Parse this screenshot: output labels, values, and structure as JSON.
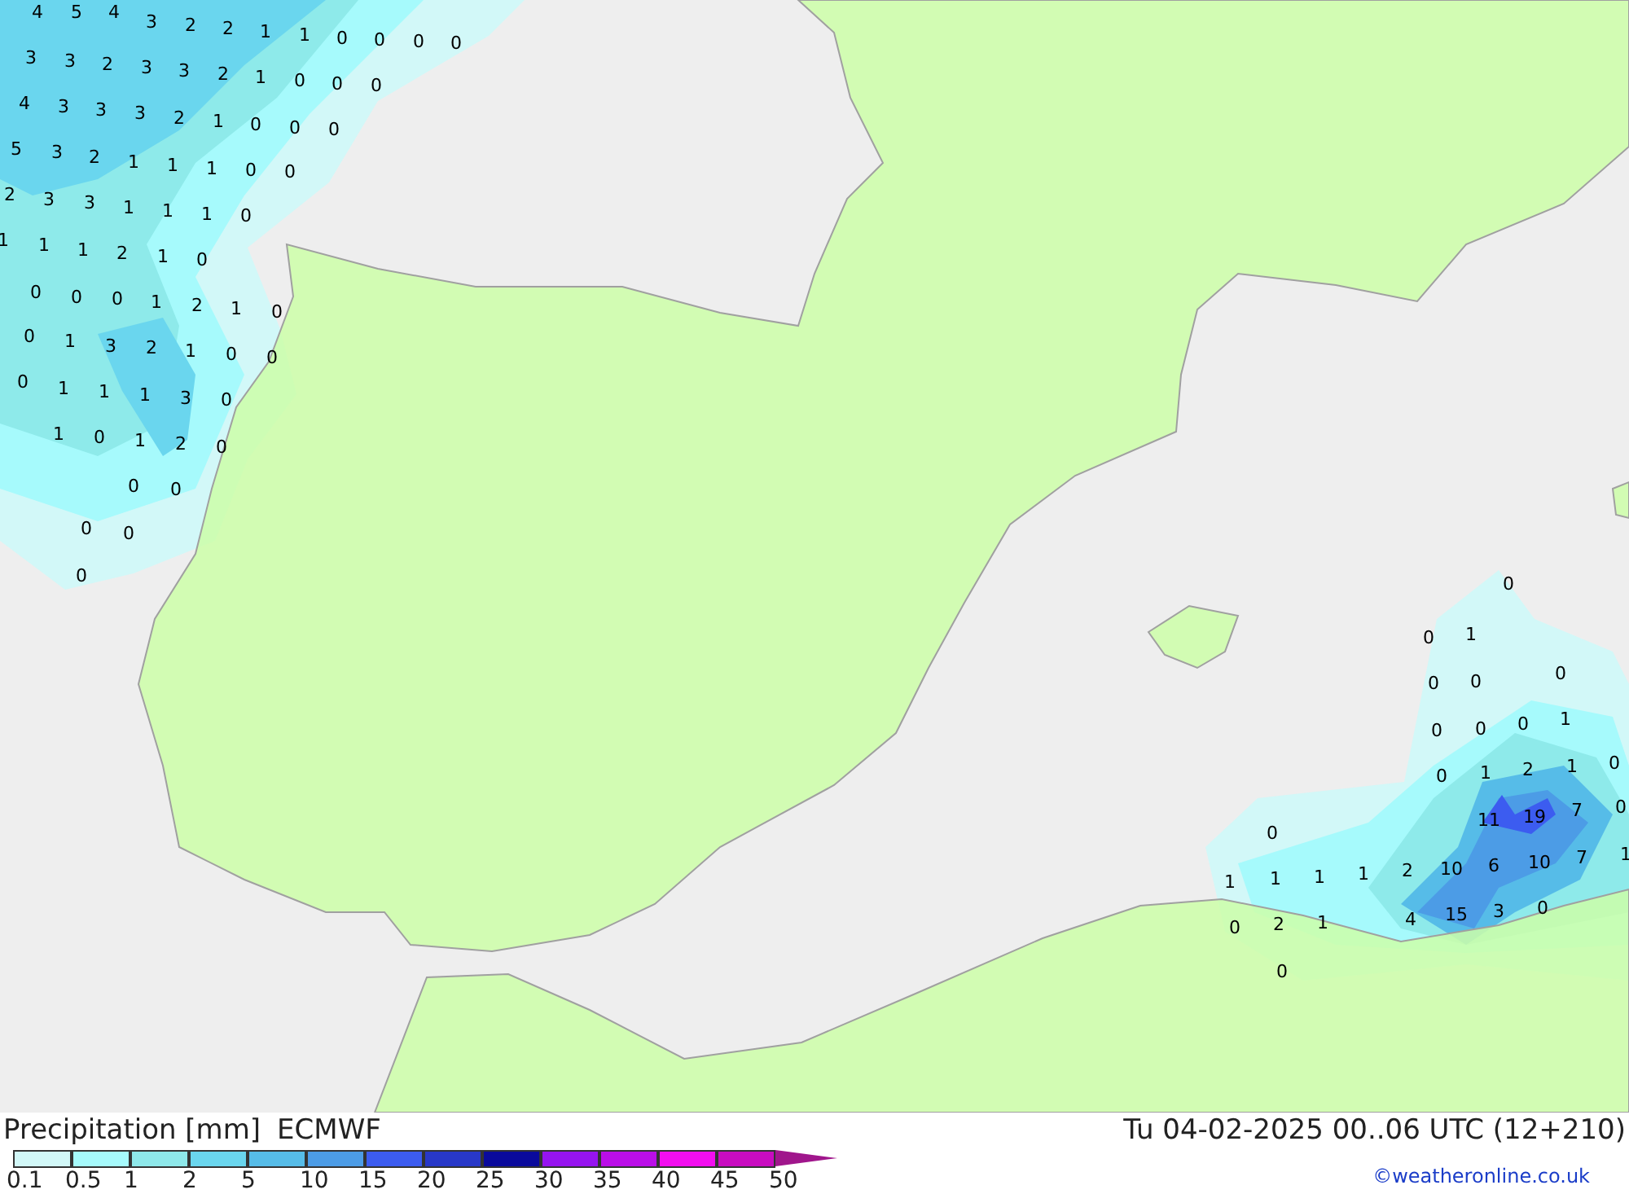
{
  "map_values": [
    "4",
    "5",
    "4",
    "3",
    "2",
    "2",
    "1",
    "1",
    "0",
    "0",
    "0",
    "0",
    "3",
    "3",
    "2",
    "3",
    "3",
    "2",
    "1",
    "0",
    "0",
    "0",
    "4",
    "3",
    "3",
    "3",
    "2",
    "1",
    "0",
    "0",
    "0",
    "5",
    "3",
    "2",
    "1",
    "1",
    "1",
    "0",
    "0",
    "2",
    "3",
    "3",
    "1",
    "1",
    "1",
    "0",
    "1",
    "1",
    "1",
    "2",
    "1",
    "0",
    "0",
    "0",
    "0",
    "1",
    "2",
    "1",
    "0",
    "0",
    "1",
    "3",
    "2",
    "1",
    "0",
    "0",
    "0",
    "1",
    "1",
    "1",
    "3",
    "0",
    "1",
    "0",
    "1",
    "2",
    "0",
    "0",
    "0",
    "0",
    "0",
    "0",
    "0",
    "0",
    "1",
    "0",
    "0",
    "0",
    "0",
    "0",
    "0",
    "1",
    "0",
    "1",
    "2",
    "1",
    "0",
    "11",
    "19",
    "7",
    "0",
    "0",
    "1",
    "1",
    "1",
    "1",
    "2",
    "10",
    "6",
    "10",
    "7",
    "1",
    "0",
    "2",
    "1",
    "4",
    "15",
    "3",
    "0",
    "0"
  ],
  "title": {
    "label": "Precipitation [mm]",
    "model": "ECMWF"
  },
  "valid_time": "Tu 04-02-2025 00..06 UTC (12+210)",
  "legend": {
    "colors": [
      {
        "color": "#d2f8f8"
      },
      {
        "color": "#a6fafc"
      },
      {
        "color": "#8ee8ea"
      },
      {
        "color": "#6ad6ee"
      },
      {
        "color": "#56bce8"
      },
      {
        "color": "#4c9ce6"
      },
      {
        "color": "#3c5cf0"
      },
      {
        "color": "#2838c8"
      },
      {
        "color": "#0a0a9c"
      },
      {
        "color": "#9614f0"
      },
      {
        "color": "#ba0ee8"
      },
      {
        "color": "#f20ef0"
      },
      {
        "color": "#c80cc0"
      }
    ],
    "ticks": [
      "0.1",
      "0.5",
      "1",
      "2",
      "5",
      "10",
      "15",
      "20",
      "25",
      "30",
      "35",
      "40",
      "45",
      "50"
    ]
  },
  "credit": "©weatheronline.co.uk"
}
